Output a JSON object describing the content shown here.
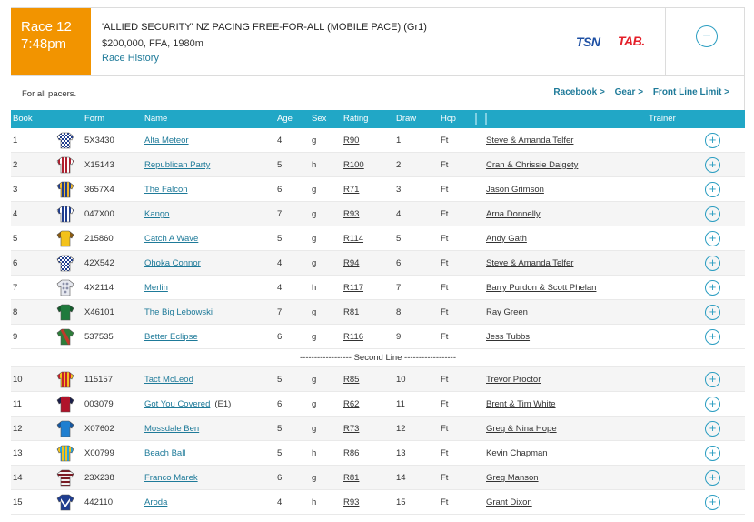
{
  "race": {
    "label": "Race 12",
    "time": "7:48pm",
    "title": "'ALLIED SECURITY' NZ PACING FREE-FOR-ALL (MOBILE PACE) (Gr1)",
    "details": "$200,000, FFA, 1980m",
    "history_link": "Race History",
    "collapse_symbol": "−"
  },
  "logos": {
    "tsn": "TSN",
    "tab": "TAB."
  },
  "description": "For all pacers.",
  "links": [
    "Racebook >",
    "Gear >",
    "Front Line Limit >"
  ],
  "columns": {
    "book": "Book",
    "form": "Form",
    "name": "Name",
    "age": "Age",
    "sex": "Sex",
    "rating": "Rating",
    "draw": "Draw",
    "hcp": "Hcp",
    "trainer": "Trainer"
  },
  "second_line_label": "------------------ Second Line ------------------",
  "add_symbol": "+",
  "runners": [
    {
      "book": "1",
      "form": "5X3430",
      "name": "Alta Meteor",
      "age": "4",
      "sex": "g",
      "rating": "R90",
      "draw": "1",
      "hcp": "Ft",
      "trainer": "Steve & Amanda Telfer",
      "silk": {
        "body": "#1f3d8f",
        "accent": "#ffffff",
        "pattern": "check"
      }
    },
    {
      "book": "2",
      "form": "X15143",
      "name": "Republican Party",
      "age": "5",
      "sex": "h",
      "rating": "R100",
      "draw": "2",
      "hcp": "Ft",
      "trainer": "Cran & Chrissie Dalgety",
      "silk": {
        "body": "#ffffff",
        "accent": "#b01e2e",
        "pattern": "stripes"
      }
    },
    {
      "book": "3",
      "form": "3657X4",
      "name": "The Falcon",
      "age": "6",
      "sex": "g",
      "rating": "R71",
      "draw": "3",
      "hcp": "Ft",
      "trainer": "Jason Grimson",
      "silk": {
        "body": "#f0b82a",
        "accent": "#1f3d8f",
        "pattern": "stripes"
      }
    },
    {
      "book": "4",
      "form": "047X00",
      "name": "Kango",
      "age": "7",
      "sex": "g",
      "rating": "R93",
      "draw": "4",
      "hcp": "Ft",
      "trainer": "Arna Donnelly",
      "silk": {
        "body": "#ffffff",
        "accent": "#1f3d8f",
        "pattern": "stripes"
      }
    },
    {
      "book": "5",
      "form": "215860",
      "name": "Catch A Wave",
      "age": "5",
      "sex": "g",
      "rating": "R114",
      "draw": "5",
      "hcp": "Ft",
      "trainer": "Andy Gath",
      "silk": {
        "body": "#f3c21c",
        "accent": "#8a5a10",
        "pattern": "plain"
      }
    },
    {
      "book": "6",
      "form": "42X542",
      "name": "Ohoka Connor",
      "age": "4",
      "sex": "g",
      "rating": "R94",
      "draw": "6",
      "hcp": "Ft",
      "trainer": "Steve & Amanda Telfer",
      "silk": {
        "body": "#1f3d8f",
        "accent": "#ffffff",
        "pattern": "check"
      }
    },
    {
      "book": "7",
      "form": "4X2114",
      "name": "Merlin",
      "age": "4",
      "sex": "h",
      "rating": "R117",
      "draw": "7",
      "hcp": "Ft",
      "trainer": "Barry Purdon & Scott Phelan",
      "silk": {
        "body": "#e6e8ef",
        "accent": "#8a8fa8",
        "pattern": "spots"
      }
    },
    {
      "book": "8",
      "form": "X46101",
      "name": "The Big Lebowski",
      "age": "7",
      "sex": "g",
      "rating": "R81",
      "draw": "8",
      "hcp": "Ft",
      "trainer": "Ray Green",
      "silk": {
        "body": "#1e7a3c",
        "accent": "#145a2b",
        "pattern": "plain"
      }
    },
    {
      "book": "9",
      "form": "537535",
      "name": "Better Eclipse",
      "age": "6",
      "sex": "g",
      "rating": "R116",
      "draw": "9",
      "hcp": "Ft",
      "trainer": "Jess Tubbs",
      "silk": {
        "body": "#2e7d3a",
        "accent": "#c0392b",
        "pattern": "sash"
      }
    },
    {
      "book": "10",
      "form": "115157",
      "name": "Tact McLeod",
      "age": "5",
      "sex": "g",
      "rating": "R85",
      "draw": "10",
      "hcp": "Ft",
      "trainer": "Trevor Proctor",
      "silk": {
        "body": "#f4c21c",
        "accent": "#c8202a",
        "pattern": "stripes"
      }
    },
    {
      "book": "11",
      "form": "003079",
      "name": "Got You Covered",
      "extra": "(E1)",
      "age": "6",
      "sex": "g",
      "rating": "R62",
      "draw": "11",
      "hcp": "Ft",
      "trainer": "Brent & Tim White",
      "silk": {
        "body": "#b0132a",
        "accent": "#1b1f4a",
        "pattern": "plain"
      }
    },
    {
      "book": "12",
      "form": "X07602",
      "name": "Mossdale Ben",
      "age": "5",
      "sex": "g",
      "rating": "R73",
      "draw": "12",
      "hcp": "Ft",
      "trainer": "Greg & Nina Hope",
      "silk": {
        "body": "#1f7fd0",
        "accent": "#1557a0",
        "pattern": "plain"
      }
    },
    {
      "book": "13",
      "form": "X00799",
      "name": "Beach Ball",
      "age": "5",
      "sex": "h",
      "rating": "R86",
      "draw": "13",
      "hcp": "Ft",
      "trainer": "Kevin Chapman",
      "silk": {
        "body": "#2aa3dd",
        "accent": "#f2c21c",
        "pattern": "stripes"
      }
    },
    {
      "book": "14",
      "form": "23X238",
      "name": "Franco Marek",
      "age": "6",
      "sex": "g",
      "rating": "R81",
      "draw": "14",
      "hcp": "Ft",
      "trainer": "Greg Manson",
      "silk": {
        "body": "#f2f2f2",
        "accent": "#7a1b24",
        "pattern": "hoops"
      }
    },
    {
      "book": "15",
      "form": "442110",
      "name": "Aroda",
      "age": "4",
      "sex": "h",
      "rating": "R93",
      "draw": "15",
      "hcp": "Ft",
      "trainer": "Grant Dixon",
      "silk": {
        "body": "#1f3d8f",
        "accent": "#ffffff",
        "pattern": "chevron"
      }
    }
  ]
}
